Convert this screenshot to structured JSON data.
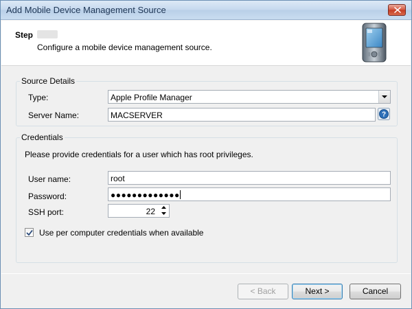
{
  "window": {
    "title": "Add Mobile Device Management Source"
  },
  "header": {
    "step_label": "Step",
    "description": "Configure a mobile device management source."
  },
  "source_details": {
    "group_label": "Source Details",
    "type_label": "Type:",
    "type_value": "Apple Profile Manager",
    "server_label": "Server Name:",
    "server_value": "MACSERVER"
  },
  "credentials": {
    "group_label": "Credentials",
    "instructions": "Please provide credentials for a user which has root privileges.",
    "username_label": "User name:",
    "username_value": "root",
    "password_label": "Password:",
    "password_value": "●●●●●●●●●●●●●",
    "ssh_label": "SSH port:",
    "ssh_value": "22",
    "checkbox_label": "Use per computer credentials when available",
    "checkbox_checked": true
  },
  "footer": {
    "back_label": "< Back",
    "next_label": "Next >",
    "cancel_label": "Cancel"
  },
  "colors": {
    "title_bar": "#c5d8ee",
    "close_button": "#c43b22",
    "help_icon": "#2c6fb8"
  }
}
